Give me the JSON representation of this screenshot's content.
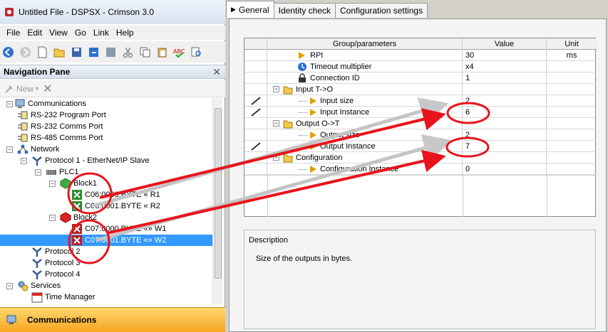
{
  "window": {
    "title": "Untitled File - DSPSX - Crimson 3.0"
  },
  "menu": [
    "File",
    "Edit",
    "View",
    "Go",
    "Link",
    "Help"
  ],
  "nav": {
    "title": "Navigation Pane",
    "new_label": "New"
  },
  "tree": [
    {
      "label": "Communications"
    },
    {
      "label": "RS-232 Program Port"
    },
    {
      "label": "RS-232 Comms Port"
    },
    {
      "label": "RS-485 Comms Port"
    },
    {
      "label": "Network"
    },
    {
      "label": "Protocol 1 - EtherNet/IP Slave"
    },
    {
      "label": "PLC1"
    },
    {
      "label": "Block1"
    },
    {
      "label": "C06:0000.BYTE « R1"
    },
    {
      "label": "C06:0001.BYTE « R2"
    },
    {
      "label": "Block2"
    },
    {
      "label": "C07:0000.BYTE «» W1"
    },
    {
      "label": "C07:0001.BYTE «» W2"
    },
    {
      "label": "Protocol 2"
    },
    {
      "label": "Protocol 3"
    },
    {
      "label": "Protocol 4"
    },
    {
      "label": "Services"
    },
    {
      "label": "Time Manager"
    }
  ],
  "bottom_section": "Communications",
  "tabs": [
    "General",
    "Identity check",
    "Configuration settings"
  ],
  "grid": {
    "headers": [
      "Group/parameters",
      "Value",
      "Unit"
    ],
    "rows": [
      {
        "name": "RPI",
        "value": "30",
        "unit": "ms"
      },
      {
        "name": "Timeout multiplier",
        "value": "x4",
        "unit": ""
      },
      {
        "name": "Connection ID",
        "value": "1",
        "unit": ""
      },
      {
        "name": "Input T->O",
        "value": "",
        "unit": ""
      },
      {
        "name": "Input size",
        "value": "2",
        "unit": ""
      },
      {
        "name": "Input Instance",
        "value": "6",
        "unit": ""
      },
      {
        "name": "Output O->T",
        "value": "",
        "unit": ""
      },
      {
        "name": "Output size",
        "value": "2",
        "unit": ""
      },
      {
        "name": "Output Instance",
        "value": "7",
        "unit": ""
      },
      {
        "name": "Configuration",
        "value": "",
        "unit": ""
      },
      {
        "name": "Configuration Instance",
        "value": "0",
        "unit": ""
      }
    ]
  },
  "description": {
    "label": "Description",
    "text": "Size of the outputs in bytes."
  },
  "colors": {
    "selection": "#3399ff",
    "annotation": "#e8141c",
    "accent_bar": "#f5a623"
  }
}
